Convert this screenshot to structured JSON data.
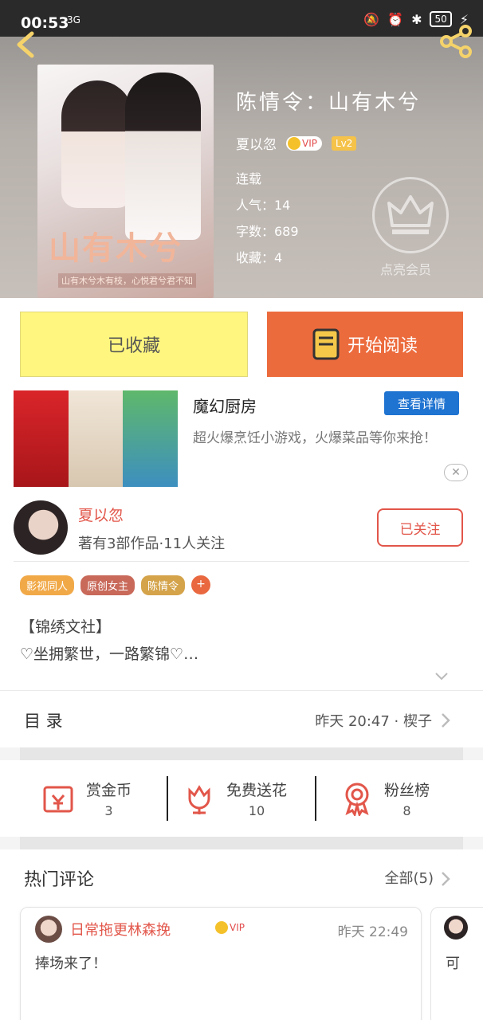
{
  "status_bar": {
    "time": "00:53",
    "network": "3G",
    "battery": "50"
  },
  "book": {
    "cover_title": "山有木兮",
    "cover_subtitle": "山有木兮木有枝，心悦君兮君不知",
    "title": "陈情令：山有木兮",
    "author": "夏以忽",
    "vip_label": "VIP",
    "level": "Lv2",
    "status": "连载",
    "popularity": "人气：14",
    "word_count": "字数：689",
    "favorites": "收藏：4",
    "member_label": "点亮会员"
  },
  "actions": {
    "favorite": "已收藏",
    "read": "开始阅读"
  },
  "ad": {
    "title": "魔幻厨房",
    "button": "查看详情",
    "description": "超火爆烹饪小游戏，火爆菜品等你来抢！",
    "close": "✕"
  },
  "author_card": {
    "name": "夏以忽",
    "stats": "著有3部作品·11人关注",
    "follow": "已关注",
    "tags": [
      {
        "label": "影视同人",
        "color": "#f1a948"
      },
      {
        "label": "原创女主",
        "color": "#c8695a"
      },
      {
        "label": "陈情令",
        "color": "#d4a34a"
      }
    ],
    "tag_plus": "+",
    "desc_line1": "【锦绣文社】",
    "desc_line2": "♡坐拥繁世，一路繁锦♡…"
  },
  "catalog": {
    "label": "目 录",
    "info": "昨天 20:47 · 楔子"
  },
  "rewards": [
    {
      "label": "赏金币",
      "value": "3"
    },
    {
      "label": "免费送花",
      "value": "10"
    },
    {
      "label": "粉丝榜",
      "value": "8"
    }
  ],
  "comments": {
    "header": "热门评论",
    "all": "全部(5)",
    "items": [
      {
        "user": "日常拖更林森挽",
        "vip": "VIP",
        "time": "昨天 22:49",
        "text": "捧场来了！"
      },
      {
        "text": "可"
      }
    ]
  },
  "colors": {
    "accent": "#ec6b3d",
    "favorite_bg": "#fff67f",
    "author_red": "#e2564a",
    "ad_blue": "#1f73d1"
  }
}
